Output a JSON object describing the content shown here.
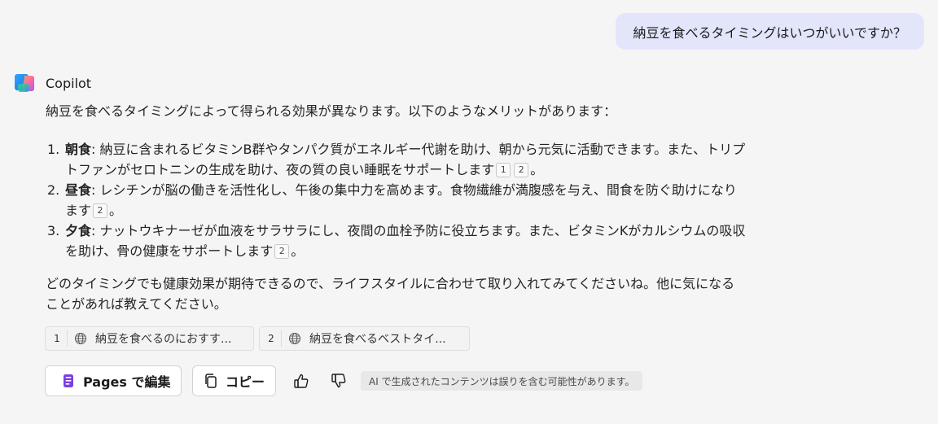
{
  "user_message": "納豆を食べるタイミングはいつがいいですか？",
  "assistant": {
    "name": "Copilot",
    "intro": "納豆を食べるタイミングによって得られる効果が異なります。以下のようなメリットがあります：",
    "items": [
      {
        "num": "1.",
        "term": "朝食",
        "text": ": 納豆に含まれるビタミンB群やタンパク質がエネルギー代謝を助け、朝から元気に活動できます。また、トリプトファンがセロトニンの生成を助け、夜の質の良い睡眠をサポートします",
        "cites": [
          "1",
          "2"
        ]
      },
      {
        "num": "2.",
        "term": "昼食",
        "text": ": レシチンが脳の働きを活性化し、午後の集中力を高めます。食物繊維が満腹感を与え、間食を防ぐ助けになります",
        "cites": [
          "2"
        ]
      },
      {
        "num": "3.",
        "term": "夕食",
        "text": ": ナットウキナーゼが血液をサラサラにし、夜間の血栓予防に役立ちます。また、ビタミンKがカルシウムの吸収を助け、骨の健康をサポートします",
        "cites": [
          "2"
        ]
      }
    ],
    "sentence_end": "。",
    "closing": "どのタイミングでも健康効果が期待できるので、ライフスタイルに合わせて取り入れてみてくださいね。他に気になることがあれば教えてください。"
  },
  "sources": [
    {
      "num": "1",
      "title": "納豆を食べるのにおすす..."
    },
    {
      "num": "2",
      "title": "納豆を食べるベストタイ..."
    }
  ],
  "actions": {
    "pages_label": "Pages で編集",
    "copy_label": "コピー",
    "disclaimer": "AI で生成されたコンテンツは誤りを含む可能性があります。"
  },
  "colors": {
    "background": "#f5f5f5",
    "user_bubble": "#e3e6fb",
    "pages_icon": "#7b3fe4"
  }
}
